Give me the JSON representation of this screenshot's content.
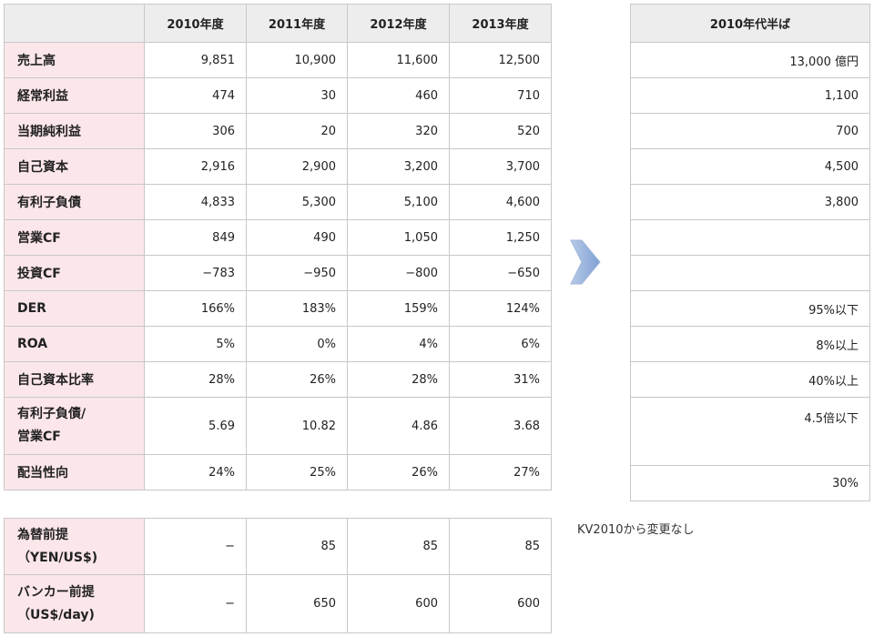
{
  "main_table": {
    "headers": [
      "",
      "2010年度",
      "2011年度",
      "2012年度",
      "2013年度"
    ],
    "rows": [
      {
        "label": "売上高",
        "values": [
          "9,851",
          "10,900",
          "11,600",
          "12,500"
        ]
      },
      {
        "label": "経常利益",
        "values": [
          "474",
          "30",
          "460",
          "710"
        ]
      },
      {
        "label": "当期純利益",
        "values": [
          "306",
          "20",
          "320",
          "520"
        ]
      },
      {
        "label": "自己資本",
        "values": [
          "2,916",
          "2,900",
          "3,200",
          "3,700"
        ]
      },
      {
        "label": "有利子負債",
        "values": [
          "4,833",
          "5,300",
          "5,100",
          "4,600"
        ]
      },
      {
        "label": "営業CF",
        "values": [
          "849",
          "490",
          "1,050",
          "1,250"
        ]
      },
      {
        "label": "投資CF",
        "values": [
          "−783",
          "−950",
          "−800",
          "−650"
        ]
      },
      {
        "label": "DER",
        "values": [
          "166%",
          "183%",
          "159%",
          "124%"
        ]
      },
      {
        "label": "ROA",
        "values": [
          "5%",
          "0%",
          "4%",
          "6%"
        ]
      },
      {
        "label": "自己資本比率",
        "values": [
          "28%",
          "26%",
          "28%",
          "31%"
        ]
      },
      {
        "label_line1": "有利子負債/",
        "label_line2": "営業CF",
        "values": [
          "5.69",
          "10.82",
          "4.86",
          "3.68"
        ]
      },
      {
        "label": "配当性向",
        "values": [
          "24%",
          "25%",
          "26%",
          "27%"
        ]
      }
    ]
  },
  "target_table": {
    "header": "2010年代半ば",
    "values": [
      "13,000 億円",
      "1,100",
      "700",
      "4,500",
      "3,800",
      "",
      "",
      "95%以下",
      "8%以上",
      "40%以上",
      "4.5倍以下",
      "30%"
    ]
  },
  "assumption_table": {
    "rows": [
      {
        "label_line1": "為替前提",
        "label_line2": "（YEN/US$)",
        "values": [
          "−",
          "85",
          "85",
          "85"
        ]
      },
      {
        "label_line1": "バンカー前提",
        "label_line2": "（US$/day)",
        "values": [
          "−",
          "650",
          "600",
          "600"
        ]
      }
    ]
  },
  "note": "KV2010から変更なし",
  "colors": {
    "label_bg": "#fbe6ea",
    "header_bg": "#ededed",
    "border": "#c8c8c8",
    "arrow": "#8fb0dc"
  },
  "icons": {
    "arrow": "right-arrow-icon"
  }
}
